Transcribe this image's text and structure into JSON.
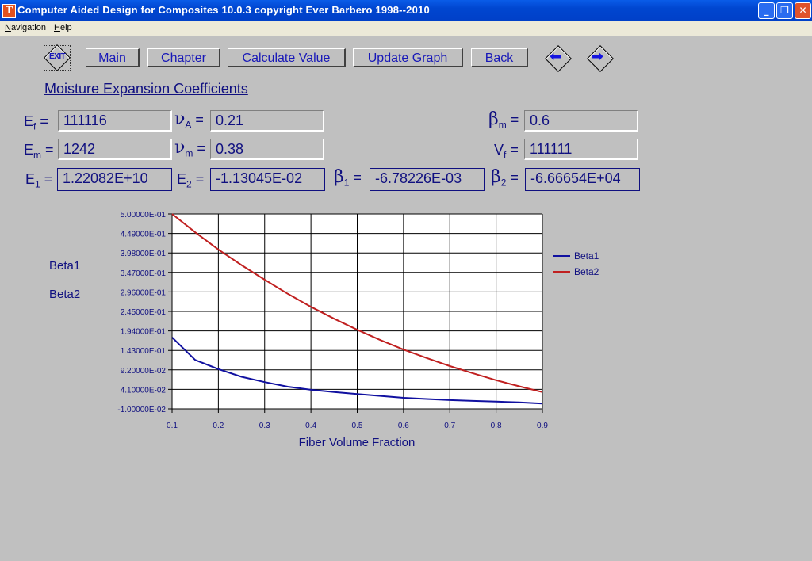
{
  "window": {
    "title": "Computer Aided Design for Composites 10.0.3 copyright Ever Barbero 1998--2010",
    "app_icon_letter": "T",
    "controls": {
      "minimize": "_",
      "restore": "❐",
      "close": "✕"
    }
  },
  "menu": [
    {
      "label": "Navigation",
      "accel": "N",
      "rest": "avigation"
    },
    {
      "label": "Help",
      "accel": "H",
      "rest": "elp"
    }
  ],
  "toolbar": {
    "exit_label": "EXIT",
    "buttons": [
      "Main",
      "Chapter",
      "Calculate Value",
      "Update Graph",
      "Back"
    ],
    "prev_icon": "left-arrow-icon",
    "next_icon": "right-arrow-icon"
  },
  "page_title": "Moisture Expansion Coefficients",
  "inputs": {
    "Ef": {
      "label": "E",
      "sub": "f",
      "value": "111116"
    },
    "Em": {
      "label": "E",
      "sub": "m",
      "value": "1242"
    },
    "nuA": {
      "label": "ν",
      "sub": "A",
      "value": "0.21"
    },
    "num": {
      "label": "ν",
      "sub": "m",
      "value": "0.38"
    },
    "betam": {
      "label": "β",
      "sub": "m",
      "value": "0.6"
    },
    "Vf": {
      "label": "V",
      "sub": "f",
      "value": "111111"
    }
  },
  "outputs": {
    "E1": {
      "label": "E",
      "sub": "1",
      "value": "1.22082E+10"
    },
    "E2": {
      "label": "E",
      "sub": "2",
      "value": "-1.13045E-02"
    },
    "beta1": {
      "label": "β",
      "sub": "1",
      "value": "-6.78226E-03"
    },
    "beta2": {
      "label": "β",
      "sub": "2",
      "value": "-6.66654E+04"
    }
  },
  "equals": "=",
  "side_labels": [
    "Beta1",
    "Beta2"
  ],
  "chart_data": {
    "type": "line",
    "title": "",
    "xlabel": "Fiber Volume Fraction",
    "ylabel": "",
    "xlim": [
      0.1,
      0.9
    ],
    "ylim": [
      -0.01,
      0.5
    ],
    "grid": true,
    "legend": "right",
    "x_ticks": [
      "0.1",
      "0.2",
      "0.3",
      "0.4",
      "0.5",
      "0.6",
      "0.7",
      "0.8",
      "0.9"
    ],
    "y_ticks": [
      "5.00000E-01",
      "4.49000E-01",
      "3.98000E-01",
      "3.47000E-01",
      "2.96000E-01",
      "2.45000E-01",
      "1.94000E-01",
      "1.43000E-01",
      "9.20000E-02",
      "4.10000E-02",
      "-1.00000E-02"
    ],
    "x": [
      0.1,
      0.15,
      0.2,
      0.25,
      0.3,
      0.35,
      0.4,
      0.45,
      0.5,
      0.55,
      0.6,
      0.65,
      0.7,
      0.75,
      0.8,
      0.85,
      0.9
    ],
    "series": [
      {
        "name": "Beta1",
        "color": "#1010a0",
        "values": [
          0.177,
          0.118,
          0.094,
          0.074,
          0.06,
          0.048,
          0.04,
          0.034,
          0.029,
          0.024,
          0.019,
          0.016,
          0.013,
          0.011,
          0.009,
          0.007,
          0.004
        ]
      },
      {
        "name": "Beta2",
        "color": "#c02020",
        "values": [
          0.5,
          0.452,
          0.407,
          0.366,
          0.328,
          0.291,
          0.257,
          0.226,
          0.197,
          0.17,
          0.145,
          0.123,
          0.102,
          0.083,
          0.065,
          0.049,
          0.034
        ]
      }
    ]
  }
}
